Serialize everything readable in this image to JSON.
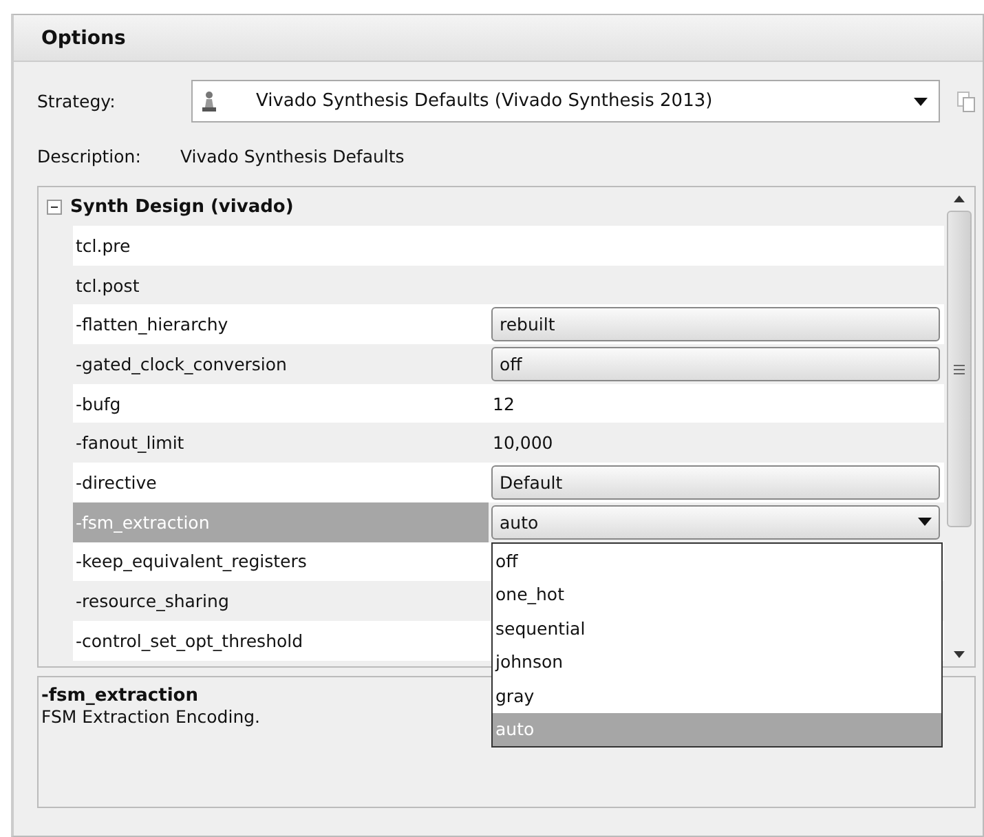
{
  "panel": {
    "title": "Options"
  },
  "strategy": {
    "label": "Strategy:",
    "value": "Vivado Synthesis Defaults (Vivado Synthesis 2013)"
  },
  "description": {
    "label": "Description:",
    "value": "Vivado Synthesis Defaults"
  },
  "grid": {
    "group": "Synth Design (vivado)",
    "expanded": true,
    "rows": [
      {
        "name": "tcl.pre",
        "kind": "empty",
        "selected": false
      },
      {
        "name": "tcl.post",
        "kind": "empty",
        "selected": false
      },
      {
        "name": "-flatten_hierarchy",
        "kind": "combo",
        "value": "rebuilt",
        "selected": false
      },
      {
        "name": "-gated_clock_conversion",
        "kind": "combo",
        "value": "off",
        "selected": false
      },
      {
        "name": "-bufg",
        "kind": "text",
        "value": "12",
        "selected": false
      },
      {
        "name": "-fanout_limit",
        "kind": "text",
        "value": "10,000",
        "selected": false
      },
      {
        "name": "-directive",
        "kind": "combo",
        "value": "Default",
        "selected": false
      },
      {
        "name": "-fsm_extraction",
        "kind": "open-combo",
        "value": "auto",
        "selected": true
      },
      {
        "name": "-keep_equivalent_registers",
        "kind": "empty",
        "selected": false
      },
      {
        "name": "-resource_sharing",
        "kind": "empty",
        "selected": false
      },
      {
        "name": "-control_set_opt_threshold",
        "kind": "empty",
        "selected": false
      }
    ]
  },
  "dropdown": {
    "options": [
      {
        "label": "off",
        "selected": false
      },
      {
        "label": "one_hot",
        "selected": false
      },
      {
        "label": "sequential",
        "selected": false
      },
      {
        "label": "johnson",
        "selected": false
      },
      {
        "label": "gray",
        "selected": false
      },
      {
        "label": "auto",
        "selected": true
      }
    ]
  },
  "help": {
    "title": "-fsm_extraction",
    "text": "FSM Extraction Encoding."
  }
}
